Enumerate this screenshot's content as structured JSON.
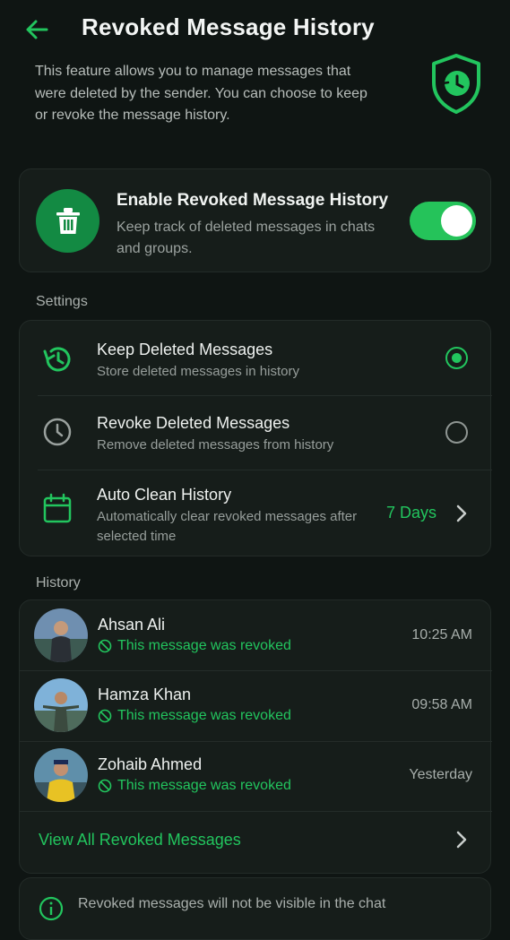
{
  "header": {
    "title": "Revoked Message History",
    "back_icon": "arrow-left-icon"
  },
  "intro": {
    "text": "This feature allows you to manage messages that were deleted by the sender. You can choose to keep or revoke the message history."
  },
  "enable": {
    "title": "Enable Revoked Message History",
    "description": "Keep track of deleted messages in chats and groups.",
    "enabled": true
  },
  "settings": {
    "label": "Settings",
    "items": [
      {
        "title": "Keep Deleted Messages",
        "description": "Store deleted messages in history",
        "selected": true,
        "icon": "history-icon"
      },
      {
        "title": "Revoke Deleted Messages",
        "description": "Remove deleted messages from history",
        "selected": false,
        "icon": "clock-icon"
      },
      {
        "title": "Auto Clean History",
        "description": "Automatically clear revoked messages after selected time",
        "value": "7 Days",
        "icon": "calendar-icon"
      }
    ]
  },
  "history": {
    "label": "History",
    "items": [
      {
        "name": "Ahsan Ali",
        "status": "This message was revoked",
        "time": "10:25 AM"
      },
      {
        "name": "Hamza Khan",
        "status": "This message was revoked",
        "time": "09:58 AM"
      },
      {
        "name": "Zohaib Ahmed",
        "status": "This message was revoked",
        "time": "Yesterday"
      }
    ],
    "view_all": "View All Revoked Messages"
  },
  "info": {
    "text": "Revoked messages will not be visible in the chat"
  },
  "colors": {
    "accent": "#22c55e",
    "background": "#0f1513",
    "card": "#161d1a"
  }
}
